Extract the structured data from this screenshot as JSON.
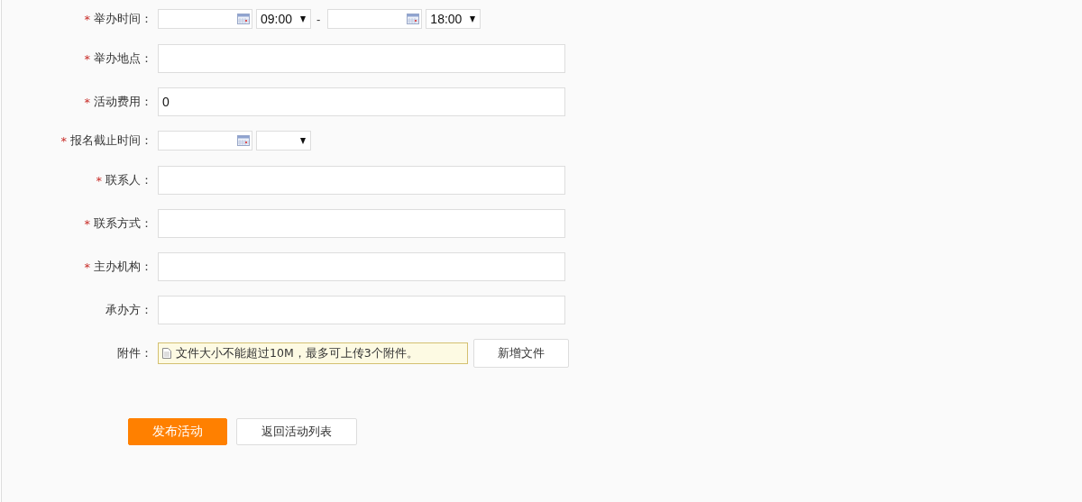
{
  "form": {
    "rows": [
      {
        "kind": "datetime_range",
        "marker": "*",
        "label": "举办时间：",
        "start_time": "09:00",
        "separator": "-",
        "end_time": "18:00"
      },
      {
        "kind": "text",
        "marker": "*",
        "label": "举办地点："
      },
      {
        "kind": "text",
        "marker": "*",
        "label": "活动费用：",
        "value": "0"
      },
      {
        "kind": "date_time",
        "marker": "*",
        "label": "报名截止时间："
      },
      {
        "kind": "text",
        "marker": "*",
        "label": "联系人："
      },
      {
        "kind": "text",
        "marker": "*",
        "label": "联系方式："
      },
      {
        "kind": "text",
        "marker": "*",
        "label": "主办机构："
      },
      {
        "kind": "text",
        "label": "承办方："
      },
      {
        "kind": "attachment",
        "label": "附件：",
        "hint": "文件大小不能超过10M，最多可上传3个附件。",
        "button": "新增文件"
      }
    ]
  },
  "actions": {
    "primary": "发布活动",
    "secondary": "返回活动列表"
  }
}
